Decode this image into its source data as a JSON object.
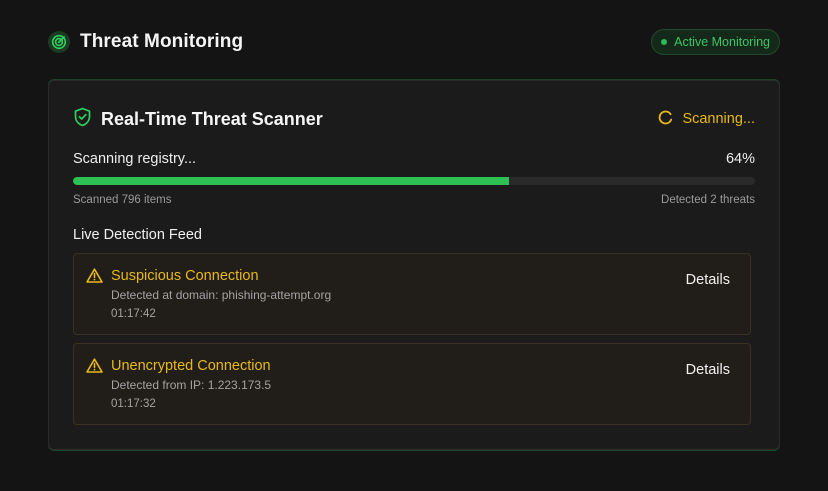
{
  "header": {
    "title": "Threat Monitoring",
    "icon": "radar-icon",
    "status_label": "Active Monitoring"
  },
  "scanner": {
    "title": "Real-Time Threat Scanner",
    "title_icon": "shield-check-icon",
    "status": "Scanning...",
    "task": "Scanning registry...",
    "progress_label": "64%",
    "progress": 0.64,
    "scanned": "Scanned 796 items",
    "detected": "Detected 2 threats"
  },
  "feed": {
    "label": "Live Detection Feed",
    "items": [
      {
        "title": "Suspicious Connection",
        "description": "Detected at domain: phishing-attempt.org",
        "time": "01:17:42",
        "action": "Details"
      },
      {
        "title": "Unencrypted Connection",
        "description": "Detected from IP: 1.223.173.5",
        "time": "01:17:32",
        "action": "Details"
      }
    ]
  },
  "colors": {
    "accent_green": "#2cc152",
    "warning_yellow": "#e8b918",
    "background": "#141414",
    "card": "#1b1b1b"
  }
}
